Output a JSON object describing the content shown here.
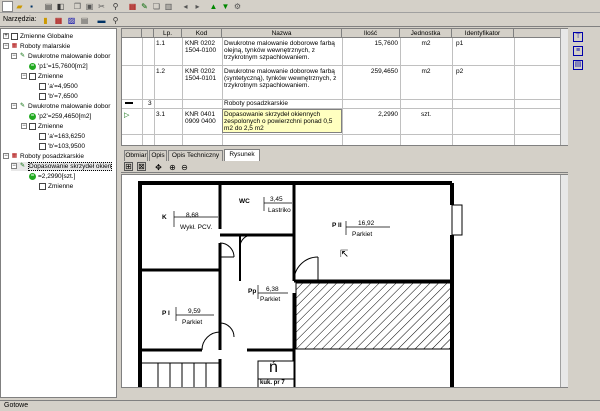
{
  "toolbar": {
    "icons": [
      "new-icon",
      "open-icon",
      "save-icon",
      "print-icon",
      "preview-icon",
      "copy-icon",
      "paste-icon",
      "cut-icon",
      "find-icon",
      "book-icon",
      "edit-icon",
      "copy2-icon",
      "delete-icon",
      "nav-left-icon",
      "nav-right-icon",
      "up-icon",
      "down-icon",
      "settings-icon"
    ]
  },
  "tools_bar": {
    "label": "Narzędzia:"
  },
  "tree": {
    "items": [
      {
        "label": "Zmienne Globalne"
      },
      {
        "label": "Roboty malarskie"
      },
      {
        "label": "Dwukrotne malowanie dobor"
      },
      {
        "label": "'p1'=15,7600[m2]"
      },
      {
        "label": "Zmienne"
      },
      {
        "label": "'a'=4,9500"
      },
      {
        "label": "'b'=7,6500"
      },
      {
        "label": "Dwukrotne malowanie dobor"
      },
      {
        "label": "'p2'=259,4650[m2]"
      },
      {
        "label": "Zmienne"
      },
      {
        "label": "'a'=163,6250"
      },
      {
        "label": "'b'=103,9500"
      },
      {
        "label": "Roboty posadzkarskie"
      },
      {
        "label": "Dopasowanie skrzydeł okien"
      },
      {
        "label": "=2,2990[szt.]"
      },
      {
        "label": "Zmienne"
      }
    ]
  },
  "grid": {
    "headers": [
      "Lp.",
      "Kod",
      "Nazwa",
      "Ilość",
      "Jednostka",
      "Identyfikator"
    ],
    "rows": [
      {
        "lp": "1.1",
        "kod": "KNR 0202 1504-0100",
        "nazwa": "Dwukrotne malowanie doborowe farbą olejną, tynków wewnętrznych, z trzykrotnym szpachlowaniem.",
        "ilosc": "15,7600",
        "jedn": "m2",
        "id": "p1"
      },
      {
        "lp": "1.2",
        "kod": "KNR 0202 1504-0101",
        "nazwa": "Dwukrotne malowanie doborowe farbą (syntetyczną), tynków wewnętrznych, z trzykrotnym szpachlowaniem.",
        "ilosc": "259,4650",
        "jedn": "m2",
        "id": "p2"
      },
      {
        "lp": "3",
        "kod": "",
        "nazwa": "Roboty posadzkarskie",
        "ilosc": "",
        "jedn": "",
        "id": ""
      },
      {
        "lp": "3.1",
        "kod": "KNR 0401 0909 0400",
        "nazwa": "Dopasowanie skrzydeł okiennych zespolonych o powierzchni ponad 0,5 m2 do 2,5 m2",
        "ilosc": "2,2990",
        "jedn": "szt.",
        "id": ""
      }
    ]
  },
  "tabs": [
    {
      "label": "Obmiar"
    },
    {
      "label": "Opis"
    },
    {
      "label": "Opis Techniczny"
    },
    {
      "label": "Rysunek"
    }
  ],
  "drawing": {
    "rooms": [
      {
        "code": "K",
        "area": "8,68",
        "name": "Wykł. PCV."
      },
      {
        "code": "WC",
        "area": "3,45",
        "name": "Lastriko"
      },
      {
        "code": "P II",
        "area": "16,92",
        "name": "Parkiet"
      },
      {
        "code": "Pp",
        "area": "6,38",
        "name": "Parkiet"
      },
      {
        "code": "P I",
        "area": "9,59",
        "name": "Parkiet"
      }
    ],
    "north_symbol": "ń",
    "stamp": "kuk. pr 7"
  },
  "status": {
    "text": "Gotowe"
  }
}
